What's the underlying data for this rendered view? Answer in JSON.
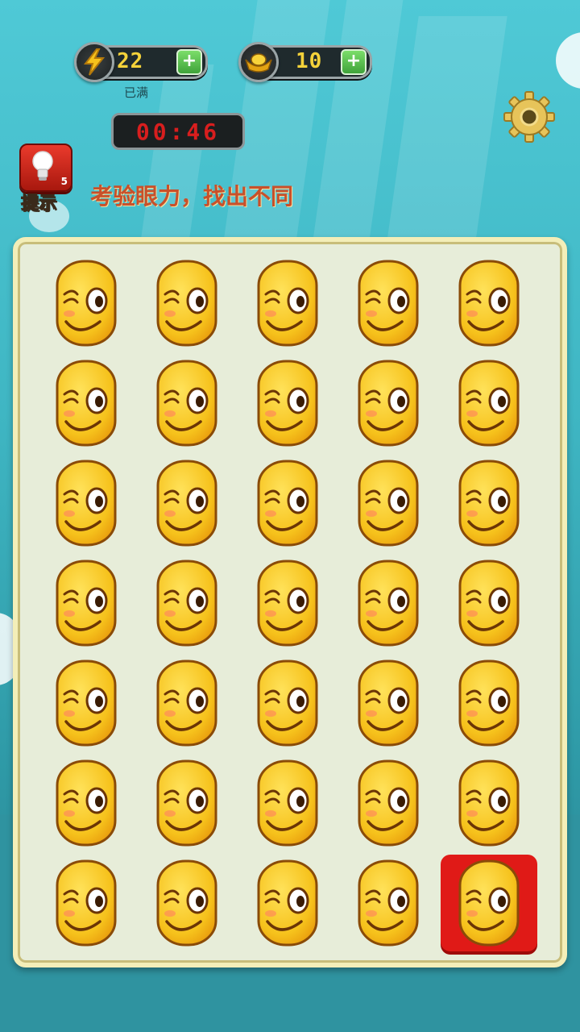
{
  "hud": {
    "energy": {
      "icon": "lightning-icon",
      "value": "22",
      "plus_label": "+"
    },
    "gold": {
      "icon": "gold-ingot-icon",
      "value": "10",
      "plus_label": "+"
    },
    "energy_status": "已满",
    "timer": "00:46",
    "settings_icon": "gear-icon"
  },
  "hint": {
    "icon": "lightbulb-icon",
    "count": "5",
    "label": "提示"
  },
  "instruction": "考验眼力，找出不同",
  "grid": {
    "rows": 7,
    "cols": 5,
    "tile_icon": "winking-smiley-icon",
    "selected": {
      "row": 6,
      "col": 4
    }
  },
  "colors": {
    "accent_red": "#e01a17",
    "face_yellow": "#f6c21c",
    "timer_red": "#d81e1e",
    "board_bg": "#e7edd9"
  }
}
